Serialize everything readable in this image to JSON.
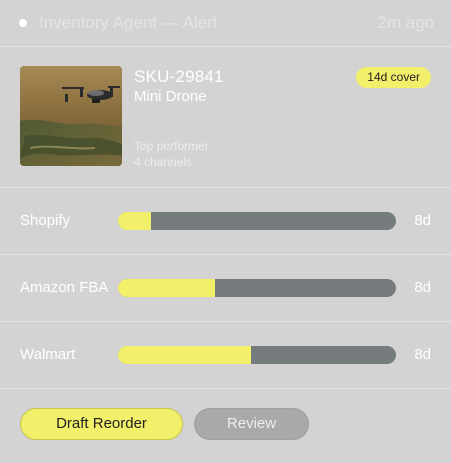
{
  "header": {
    "title": "Inventory Agent — Alert",
    "time": "2m ago"
  },
  "product": {
    "sku": "SKU-29841",
    "name": "Mini Drone",
    "badge": "14d cover",
    "tag": "Top performer",
    "channels_count": "4 channels",
    "image_icon": "drone-photo"
  },
  "channels": [
    {
      "name": "Shopify",
      "days": "8d",
      "fill_fraction": 0.12
    },
    {
      "name": "Amazon FBA",
      "days": "8d",
      "fill_fraction": 0.35
    },
    {
      "name": "Walmart",
      "days": "8d",
      "fill_fraction": 0.48
    }
  ],
  "actions": {
    "primary_label": "Draft Reorder",
    "secondary_label": "Review"
  },
  "colors": {
    "accent": "#f2ef6a",
    "bar_track": "#767b7e",
    "background": "#d3d3d3"
  }
}
